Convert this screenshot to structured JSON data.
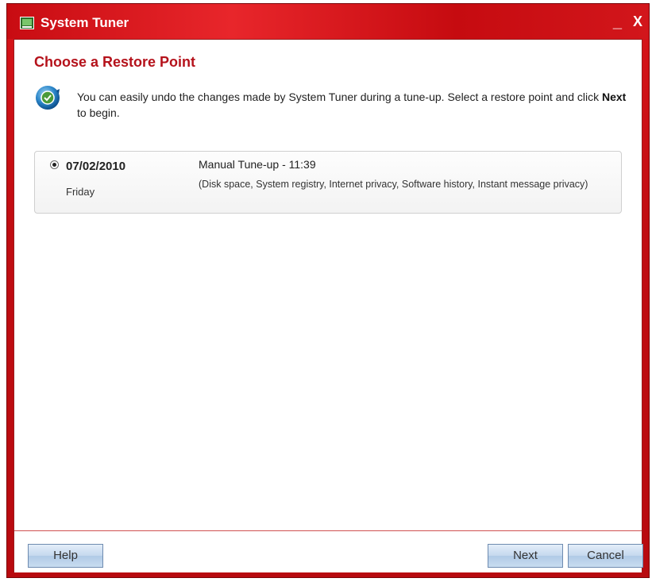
{
  "window": {
    "title": "System Tuner",
    "minimize_label": "_",
    "close_label": "X"
  },
  "page": {
    "heading": "Choose a Restore Point",
    "intro_before": "You can easily undo the changes made by System Tuner during a tune-up. Select a restore point and click ",
    "intro_bold": "Next",
    "intro_after": " to begin."
  },
  "restore_points": [
    {
      "selected": true,
      "date": "07/02/2010",
      "day": "Friday",
      "name": "Manual Tune-up - 11:39",
      "description": "(Disk space, System registry, Internet privacy, Software history, Instant message privacy)"
    }
  ],
  "buttons": {
    "help": "Help",
    "next": "Next",
    "cancel": "Cancel"
  },
  "colors": {
    "title_bar": "#d8141a",
    "heading": "#b5121b",
    "button": "#c4d8ee"
  }
}
